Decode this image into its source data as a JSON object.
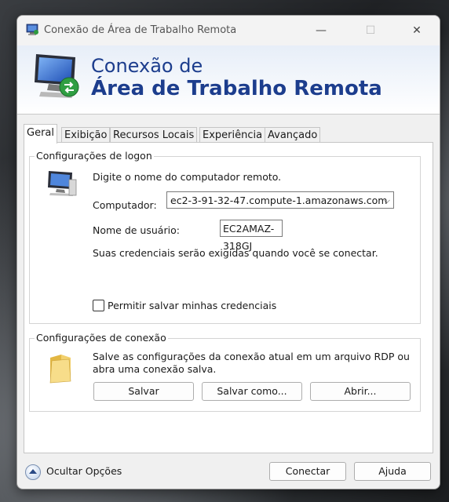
{
  "window": {
    "title": "Conexão de Área de Trabalho Remota",
    "minimize_glyph": "—",
    "maximize_glyph": "☐",
    "close_glyph": "✕"
  },
  "banner": {
    "line1": "Conexão de",
    "line2": "Área de Trabalho Remota"
  },
  "tabs": [
    {
      "label": "Geral",
      "active": true
    },
    {
      "label": "Exibição"
    },
    {
      "label": "Recursos Locais"
    },
    {
      "label": "Experiência"
    },
    {
      "label": "Avançado"
    }
  ],
  "logon": {
    "group_label": "Configurações de logon",
    "intro": "Digite o nome do computador remoto.",
    "computer_label": "Computador:",
    "computer_value": "ec2-3-91-32-47.compute-1.amazonaws.com",
    "username_label": "Nome de usuário:",
    "username_value": "EC2AMAZ-318GJ",
    "credentials_note": "Suas credenciais serão exigidas quando você se conectar.",
    "save_credentials_label": "Permitir salvar minhas credenciais",
    "save_credentials_checked": false
  },
  "connection": {
    "group_label": "Configurações de conexão",
    "description_line1": "Salve as configurações da conexão atual em um arquivo RDP ou",
    "description_line2": "abra uma conexão salva.",
    "save_label": "Salvar",
    "save_as_label": "Salvar como...",
    "open_label": "Abrir..."
  },
  "footer": {
    "hide_options_label": "Ocultar Opções",
    "connect_label": "Conectar",
    "help_label": "Ajuda"
  },
  "icons": {
    "title_icon": "remote-desktop-icon",
    "banner_icon": "remote-desktop-monitor-icon",
    "logon_icon": "computer-icon",
    "connection_icon": "folder-icon",
    "hide_options_icon": "chevron-up-circle-icon"
  }
}
